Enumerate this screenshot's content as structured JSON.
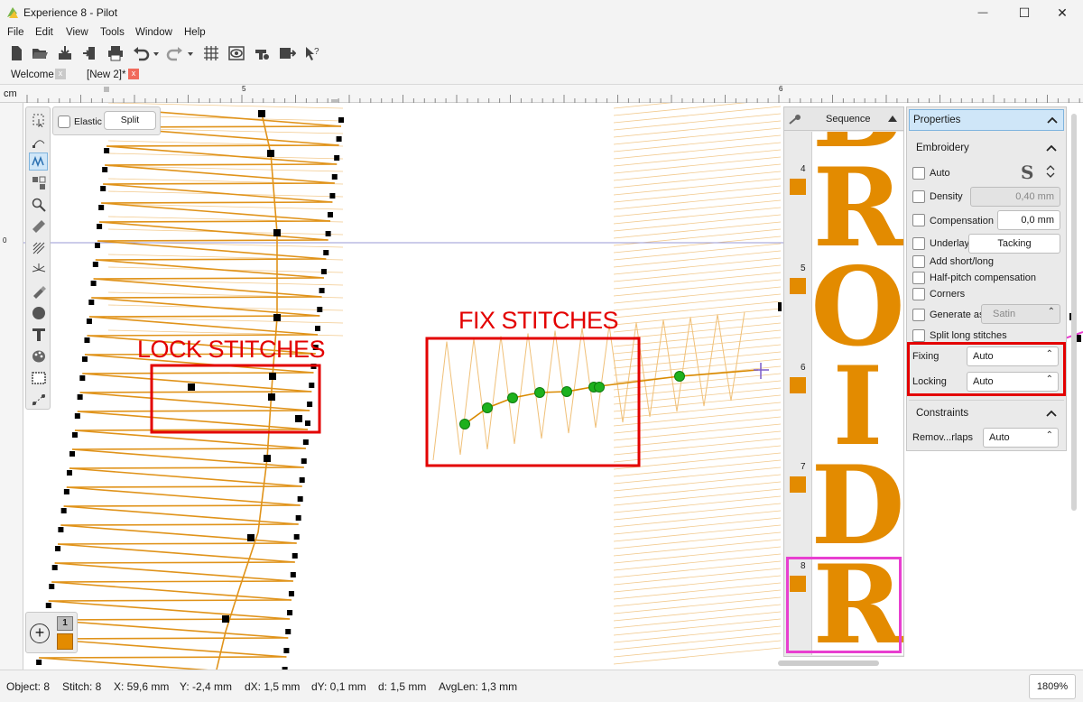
{
  "window": {
    "title": "Experience 8 - Pilot",
    "minimize_glyph": "—",
    "maximize_glyph": "☐",
    "close_glyph": "✕"
  },
  "menu": [
    "File",
    "Edit",
    "View",
    "Tools",
    "Window",
    "Help"
  ],
  "toolbar_icons": [
    "new-file-icon",
    "open-folder-icon",
    "import-icon",
    "export-icon",
    "print-icon",
    "undo-icon",
    "redo-icon",
    "grid-icon",
    "preview-icon",
    "machine-icon",
    "send-icon",
    "help-icon"
  ],
  "tabs": [
    {
      "label": "Welcome",
      "close": "x"
    },
    {
      "label": "[New 2]*",
      "close": "x"
    }
  ],
  "ruler": {
    "unit": "cm",
    "top_ticks": [
      "5",
      "6"
    ],
    "left_ticks": [
      "0"
    ]
  },
  "tools": [
    "selection-icon",
    "node-edit-icon",
    "stitch-edit-icon",
    "sequence-icon",
    "zoom-icon",
    "measure-icon",
    "fill-icon",
    "burst-icon",
    "paint-icon",
    "circle-icon",
    "text-icon",
    "palette-icon",
    "frame-icon",
    "path-icon"
  ],
  "elastic_panel": {
    "elastic_label": "Elastic",
    "split_label": "Split"
  },
  "zoom_widget": {
    "add_glyph": "+",
    "page_number": "1"
  },
  "annotations": {
    "lock_stitches": "LOCK STITCHES",
    "fix_stitches": "FIX STITCHES"
  },
  "sequence": {
    "title": "Sequence",
    "rows": [
      {
        "num": "",
        "letter": "B"
      },
      {
        "num": "4",
        "letter": "R"
      },
      {
        "num": "5",
        "letter": "O"
      },
      {
        "num": "6",
        "letter": "I"
      },
      {
        "num": "7",
        "letter": "D"
      },
      {
        "num": "8",
        "letter": "R"
      }
    ]
  },
  "properties": {
    "title": "Properties",
    "embroidery_section": "Embroidery",
    "auto_label": "Auto",
    "auto_checked": false,
    "density_label": "Density",
    "density_checked": false,
    "density_value": "0,40 mm",
    "compensation_label": "Compensation",
    "compensation_checked": true,
    "compensation_value": "0,0 mm",
    "underlay_label": "Underlay",
    "underlay_checked": true,
    "underlay_button": "Tacking",
    "add_short_long_label": "Add short/long",
    "add_short_long_checked": true,
    "half_pitch_label": "Half-pitch compensation",
    "half_pitch_checked": true,
    "corners_label": "Corners",
    "corners_checked": true,
    "generate_as_label": "Generate as:",
    "generate_as_checked": false,
    "generate_as_value": "Satin",
    "split_long_label": "Split long stitches",
    "split_long_checked": true,
    "fixing_label": "Fixing",
    "fixing_value": "Auto",
    "locking_label": "Locking",
    "locking_value": "Auto",
    "constraints_section": "Constraints",
    "remove_overlaps_label": "Remov...rlaps",
    "remove_overlaps_value": "Auto"
  },
  "status": {
    "object": "Object: 8",
    "stitch": "Stitch: 8",
    "x": "X: 59,6 mm",
    "y": "Y: -2,4 mm",
    "dx": "dX: 1,5 mm",
    "dy": "dY: 0,1 mm",
    "d": "d: 1,5 mm",
    "avglen": "AvgLen: 1,3 mm",
    "zoom": "1809%"
  },
  "colors": {
    "thread": "#e38b00",
    "annotation_red": "#e30000",
    "highlight_magenta": "#e83fd0",
    "fix_point_green": "#1db11d",
    "accent": "#cfe6f8"
  }
}
